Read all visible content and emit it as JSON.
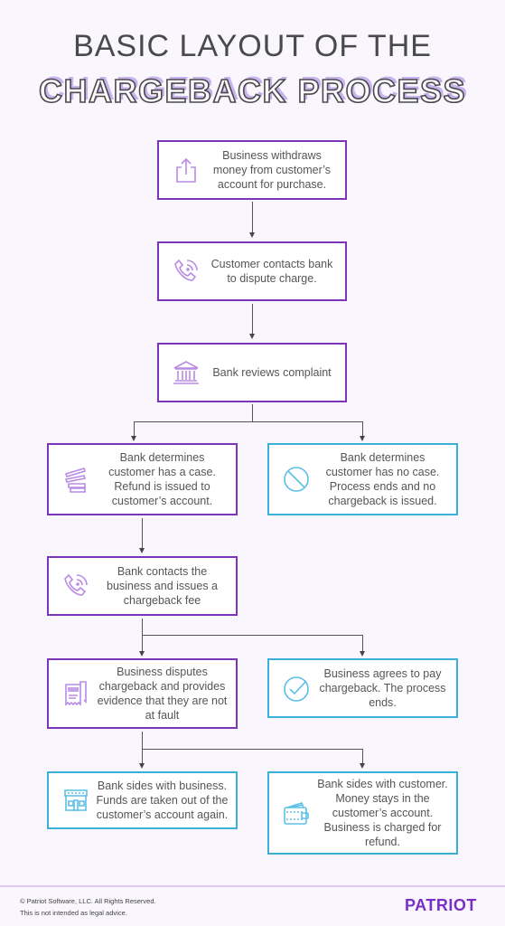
{
  "title": {
    "line1": "BASIC LAYOUT OF THE",
    "line2": "CHARGEBACK PROCESS"
  },
  "colors": {
    "purple_border": "#7a35b8",
    "blue_border": "#3ab0d6",
    "purple_icon": "#b98be6",
    "blue_icon": "#5bc0e6",
    "title_shadow": "#c9b3ef",
    "logo": "#7a2fc4"
  },
  "steps": [
    {
      "id": "withdraw",
      "icon": "share-upload-icon",
      "style": "purple",
      "text": "Business withdraws money from customer’s account for purchase."
    },
    {
      "id": "contact-bank",
      "icon": "phone-icon",
      "style": "purple",
      "text": "Customer contacts bank to dispute charge."
    },
    {
      "id": "review",
      "icon": "bank-icon",
      "style": "purple",
      "text": "Bank reviews complaint"
    },
    {
      "id": "has-case",
      "icon": "stacked-bills-icon",
      "style": "purple",
      "text": "Bank determines customer has a case. Refund is issued to customer’s account."
    },
    {
      "id": "no-case",
      "icon": "prohibited-icon",
      "style": "blue",
      "text": "Bank determines customer has no case. Process ends and no chargeback is issued."
    },
    {
      "id": "contact-business",
      "icon": "phone-icon",
      "style": "purple",
      "text": "Bank contacts the business and issues a chargeback fee"
    },
    {
      "id": "dispute",
      "icon": "receipt-icon",
      "style": "purple",
      "text": "Business disputes chargeback and provides evidence that they are not at fault"
    },
    {
      "id": "agree",
      "icon": "checkmark-circle-icon",
      "style": "blue",
      "text": "Business agrees to pay chargeback. The process ends."
    },
    {
      "id": "side-business",
      "icon": "storefront-icon",
      "style": "blue",
      "text": "Bank sides with business. Funds are taken out of the customer’s account again."
    },
    {
      "id": "side-customer",
      "icon": "wallet-icon",
      "style": "blue",
      "text": "Bank sides with customer. Money stays in the customer’s account. Business is charged for refund."
    }
  ],
  "footer": {
    "copyright": "© Patriot Software, LLC. All Rights Reserved.",
    "disclaimer": "This is not intended as legal advice.",
    "logo": "PATRIOT"
  }
}
